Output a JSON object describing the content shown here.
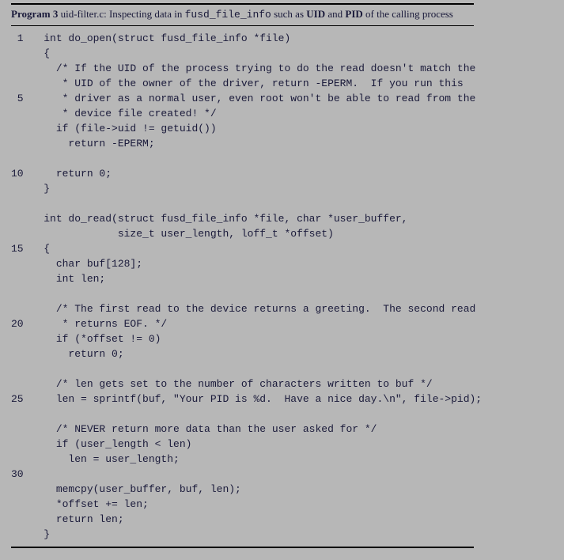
{
  "caption": {
    "prefix": "Program 3",
    "filename": " uid-filter.c: ",
    "desc1": "Inspecting data in ",
    "struct_name": "fusd_file_info",
    "desc2": " such as ",
    "uid": "UID",
    "desc3": " and ",
    "pid": "PID",
    "desc4": " of the calling process"
  },
  "code_lines": [
    {
      "n": "1",
      "t": "  int do_open(struct fusd_file_info *file)"
    },
    {
      "n": "",
      "t": "  {"
    },
    {
      "n": "",
      "t": "    /* If the UID of the process trying to do the read doesn't match the"
    },
    {
      "n": "",
      "t": "     * UID of the owner of the driver, return -EPERM.  If you run this"
    },
    {
      "n": "5",
      "t": "     * driver as a normal user, even root won't be able to read from the"
    },
    {
      "n": "",
      "t": "     * device file created! */"
    },
    {
      "n": "",
      "t": "    if (file->uid != getuid())"
    },
    {
      "n": "",
      "t": "      return -EPERM;"
    },
    {
      "n": "",
      "t": "  "
    },
    {
      "n": "10",
      "t": "    return 0;"
    },
    {
      "n": "",
      "t": "  }"
    },
    {
      "n": "",
      "t": "  "
    },
    {
      "n": "",
      "t": "  int do_read(struct fusd_file_info *file, char *user_buffer,"
    },
    {
      "n": "",
      "t": "              size_t user_length, loff_t *offset)"
    },
    {
      "n": "15",
      "t": "  {"
    },
    {
      "n": "",
      "t": "    char buf[128];"
    },
    {
      "n": "",
      "t": "    int len;"
    },
    {
      "n": "",
      "t": "  "
    },
    {
      "n": "",
      "t": "    /* The first read to the device returns a greeting.  The second read"
    },
    {
      "n": "20",
      "t": "     * returns EOF. */"
    },
    {
      "n": "",
      "t": "    if (*offset != 0)"
    },
    {
      "n": "",
      "t": "      return 0;"
    },
    {
      "n": "",
      "t": "  "
    },
    {
      "n": "",
      "t": "    /* len gets set to the number of characters written to buf */"
    },
    {
      "n": "25",
      "t": "    len = sprintf(buf, \"Your PID is %d.  Have a nice day.\\n\", file->pid);"
    },
    {
      "n": "",
      "t": "  "
    },
    {
      "n": "",
      "t": "    /* NEVER return more data than the user asked for */"
    },
    {
      "n": "",
      "t": "    if (user_length < len)"
    },
    {
      "n": "",
      "t": "      len = user_length;"
    },
    {
      "n": "30",
      "t": "  "
    },
    {
      "n": "",
      "t": "    memcpy(user_buffer, buf, len);"
    },
    {
      "n": "",
      "t": "    *offset += len;"
    },
    {
      "n": "",
      "t": "    return len;"
    },
    {
      "n": "",
      "t": "  }"
    }
  ]
}
